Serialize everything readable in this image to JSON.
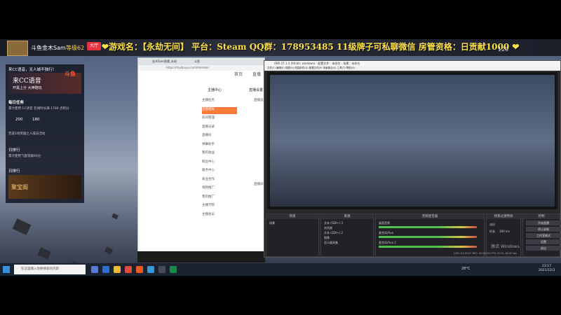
{
  "header": {
    "streamer_name": "斗鱼金木Sam",
    "level_label": "等级62",
    "live_label": "大厅",
    "ticker": "❤游戏名：【永劫无间】 平台：Steam QQ群：178953485 11级牌子可私聊微信 房管资格：日贡献1000 ❤",
    "viewer_count": "120"
  },
  "left_panel": {
    "top_text": "来CC语音，无人城不独行！",
    "banner_title": "来CC语音",
    "banner_sub": "开黑上分 大神陪玩",
    "daily_task": "每日任务",
    "task_line": "累计使用 CC语音 在线时长满 1700 点积分",
    "num1": "200",
    "num2": "180",
    "desc": "完成1场英雄之人成员活动",
    "section2": "日排行",
    "section2_line": "累计使用飞蛋等级60分",
    "section3": "日排行",
    "jbg_label": "聚宝阁"
  },
  "browser": {
    "tab1": "金木Sam直播_永劫",
    "tab2": "斗鱼",
    "url": "https://mydouyu.com/member",
    "nav_home": "首页",
    "nav_live": "直播",
    "section_title": "主播中心",
    "side_items": [
      "主播任务",
      "直播相关",
      "房间管理",
      "直播记录",
      "直播间",
      "弹幕助手",
      "我的收益",
      "粉丝中心",
      "服务中心",
      "商业合作",
      "视频推广",
      "我的推广",
      "主播学院",
      "主播会员"
    ],
    "right_title": "直播设置",
    "right_sub": "直播设",
    "right_sub2": "直播间",
    "logo": "斗鱼"
  },
  "obs": {
    "title": "OBS 27.1.3 (64-bit, windows) - 配置文件：未命名 - 场景：未命名",
    "menu": "文件(F)  编辑(E)  视图(V)  停靠部件(D)  配置文件(P)  场景集合(S)  工具(T)  帮助(H)",
    "docks": {
      "scenes": "场景",
      "sources": "来源",
      "mixer": "音频混音器",
      "transitions": "场景过渡特效",
      "controls": "控制"
    },
    "scene_items": [
      "场景"
    ],
    "source_items": [
      "文本 (GDI+) 3",
      "浏览器",
      "文本 (GDI+) 2",
      "图像",
      "显示器采集"
    ],
    "mixer_rows": [
      "桌面音频",
      "麦克风/Aux",
      "麦克风/Aux 2"
    ],
    "transition": "淡出",
    "duration_label": "时长",
    "duration_value": "300 ms",
    "control_buttons": [
      "开始直播",
      "停止录制",
      "工作室模式",
      "设置",
      "退出"
    ],
    "status": "LIVE: 01:25:47   REC: 00:00:00   CPU: 9.1%, 60.00 fps",
    "activate_text": "激活 Windows"
  },
  "taskbar": {
    "search_placeholder": "在这里输入你要搜索的内容",
    "time": "23:17",
    "date": "2021/12/3",
    "weather": "28°C"
  },
  "colors": {
    "accent": "#f25a1e",
    "ticker": "#ffe24a",
    "live": "#e5343c"
  }
}
